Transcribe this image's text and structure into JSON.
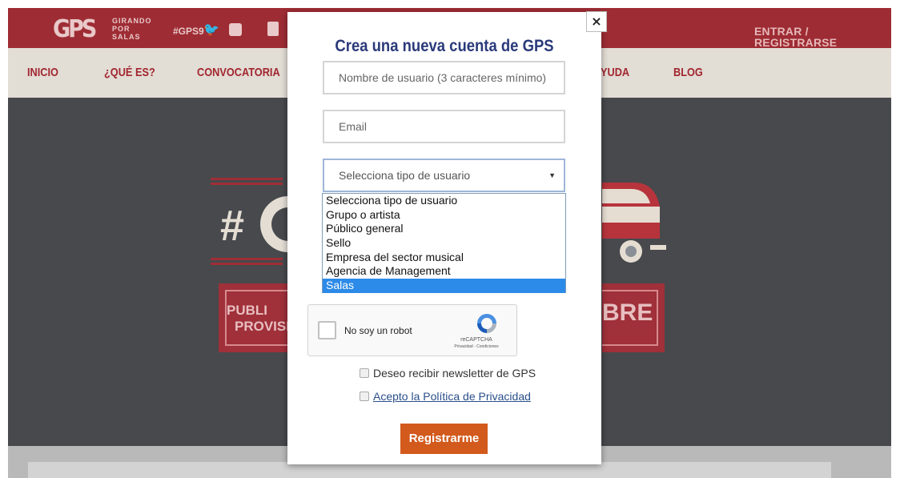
{
  "header": {
    "logo_text": "GPS",
    "logo_tagline": [
      "GIRANDO",
      "POR",
      "SALAS"
    ],
    "hashtag": "#GPS9",
    "social_icons": [
      "twitter-icon",
      "facebook-icon",
      "youtube-icon"
    ],
    "login_label": "ENTRAR / REGISTRARSE"
  },
  "nav": {
    "items": [
      {
        "label": "INICIO"
      },
      {
        "label": "¿QUÉ ES?"
      },
      {
        "label": "CONVOCATORIA"
      },
      {
        "label": "YUDA"
      },
      {
        "label": "BLOG"
      }
    ]
  },
  "hero": {
    "hash_text": "#",
    "left_box_lines": [
      "PUBLI",
      "PROVISI"
    ],
    "right_box_text": "BRE"
  },
  "modal": {
    "close_label": "×",
    "title": "Crea una nueva cuenta de GPS",
    "username_placeholder": "Nombre de usuario (3 caracteres mínimo)",
    "email_placeholder": "Email",
    "user_type": {
      "selected": "Selecciona tipo de usuario",
      "options": [
        "Selecciona tipo de usuario",
        "Grupo o artista",
        "Público general",
        "Sello",
        "Empresa del sector musical",
        "Agencia de Management",
        "Salas"
      ],
      "highlighted": "Salas"
    },
    "recaptcha": {
      "label": "No soy un robot",
      "brand": "reCAPTCHA",
      "links": "Privacidad - Condiciones"
    },
    "newsletter_label": "Deseo recibir newsletter de GPS",
    "privacy_label": "Acepto la Política de Privacidad",
    "submit_label": "Registrarme"
  },
  "colors": {
    "brand_red": "#9e2c34",
    "nav_bg": "#e2ddd5",
    "title_blue": "#2a3a7a",
    "submit_orange": "#d25a1c",
    "dropdown_highlight": "#2c8ae8"
  }
}
